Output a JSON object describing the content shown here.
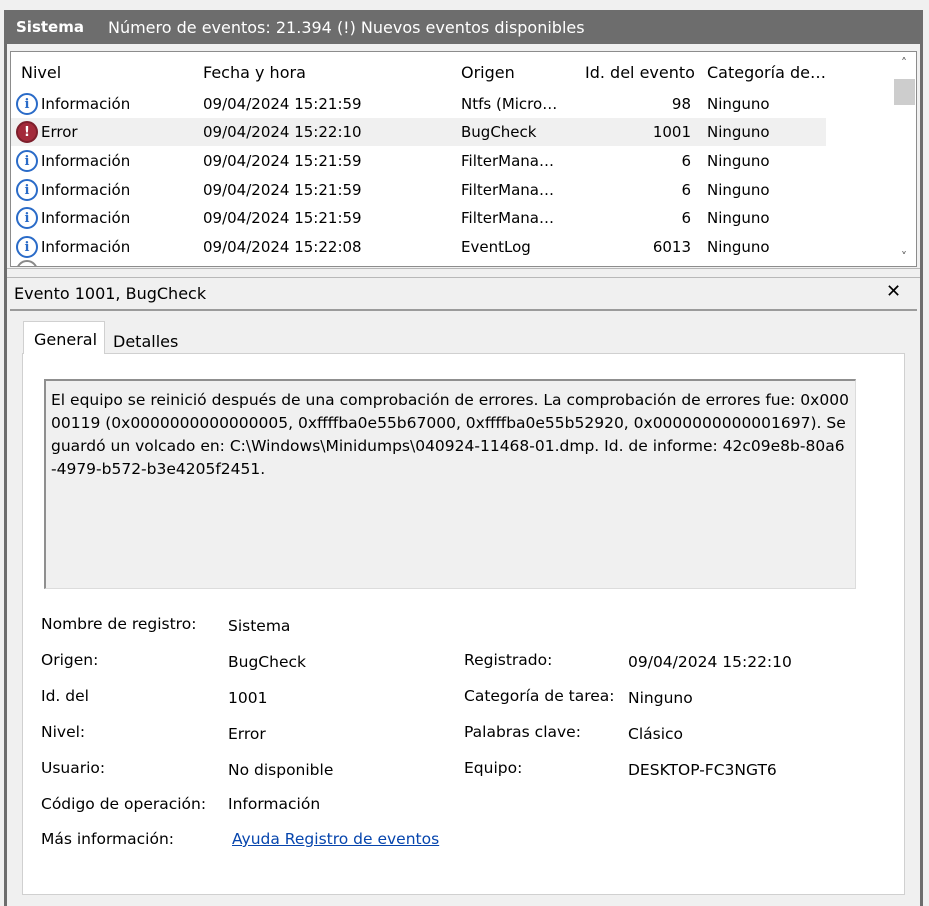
{
  "header": {
    "title": "Sistema",
    "count_text": "Número de eventos: 21.394 (!) Nuevos eventos disponibles"
  },
  "list": {
    "columns": [
      "Nivel",
      "Fecha y hora",
      "Origen",
      "Id. del evento",
      "Categoría de…"
    ],
    "rows": [
      {
        "level": "Información",
        "icon": "info-icon",
        "date": "09/04/2024 15:21:59",
        "source": "Ntfs (Micro…",
        "id": "98",
        "category": "Ninguno"
      },
      {
        "level": "Error",
        "icon": "error-icon",
        "date": "09/04/2024 15:22:10",
        "source": "BugCheck",
        "id": "1001",
        "category": "Ninguno"
      },
      {
        "level": "Información",
        "icon": "info-icon",
        "date": "09/04/2024 15:21:59",
        "source": "FilterMana…",
        "id": "6",
        "category": "Ninguno"
      },
      {
        "level": "Información",
        "icon": "info-icon",
        "date": "09/04/2024 15:21:59",
        "source": "FilterMana…",
        "id": "6",
        "category": "Ninguno"
      },
      {
        "level": "Información",
        "icon": "info-icon",
        "date": "09/04/2024 15:21:59",
        "source": "FilterMana…",
        "id": "6",
        "category": "Ninguno"
      },
      {
        "level": "Información",
        "icon": "info-icon",
        "date": "09/04/2024 15:22:08",
        "source": "EventLog",
        "id": "6013",
        "category": "Ninguno"
      }
    ]
  },
  "detail": {
    "title": "Evento 1001, BugCheck",
    "tabs": [
      "General",
      "Detalles"
    ],
    "description": "El equipo se reinició después de una comprobación de errores. La comprobación de errores fue: 0x00000119 (0x0000000000000005, 0xffffba0e55b67000, 0xffffba0e55b52920, 0x0000000000001697). Se guardó un volcado en: C:\\Windows\\Minidumps\\040924-11468-01.dmp. Id. de informe: 42c09e8b-80a6-4979-b572-b3e4205f2451.",
    "fields": {
      "log_name_label": "Nombre de registro:",
      "log_name": "Sistema",
      "source_label": "Origen:",
      "source": "BugCheck",
      "logged_label": "Registrado:",
      "logged": "09/04/2024 15:22:10",
      "event_id_label": "Id. del",
      "event_id": "1001",
      "task_category_label": "Categoría de tarea:",
      "task_category": "Ninguno",
      "level_label": "Nivel:",
      "level": "Error",
      "keywords_label": "Palabras clave:",
      "keywords": "Clásico",
      "user_label": "Usuario:",
      "user": "No disponible",
      "computer_label": "Equipo:",
      "computer": "DESKTOP-FC3NGT6",
      "opcode_label": "Código de operación:",
      "opcode": "Información",
      "more_info_label": "Más información:",
      "more_info_link": "Ayuda Registro de eventos"
    }
  },
  "colors": {
    "header_bg": "#6d6d6d",
    "info_icon": "#2a6bc8",
    "error_icon": "#a32a3a",
    "link": "#0645ad"
  }
}
